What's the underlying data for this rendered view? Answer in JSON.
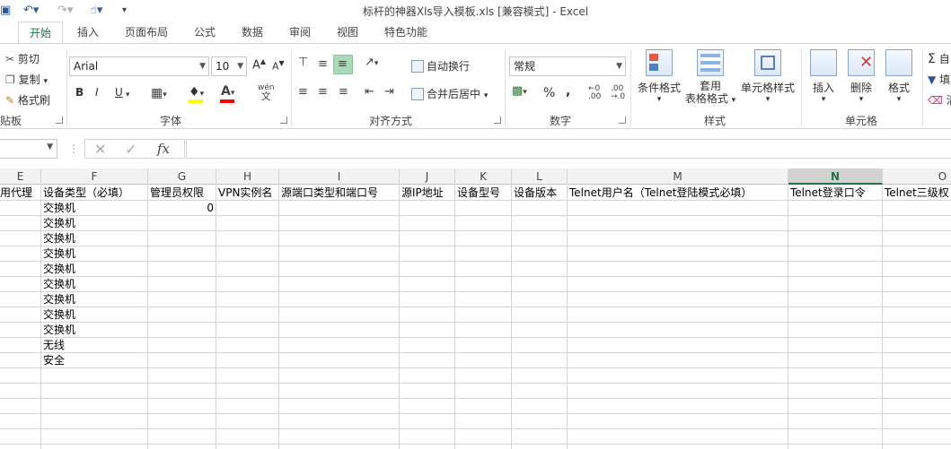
{
  "window": {
    "title": "标杆的神器Xls导入模板.xls  [兼容模式] - Excel"
  },
  "tabs": [
    "开始",
    "插入",
    "页面布局",
    "公式",
    "数据",
    "审阅",
    "视图",
    "特色功能"
  ],
  "clipboard": {
    "cut": "剪切",
    "copy": "复制",
    "painter": "格式刷",
    "label": "贴板"
  },
  "font": {
    "name": "Arial",
    "size": "10",
    "bold": "B",
    "italic": "I",
    "underline": "U",
    "grow": "A",
    "shrink": "A",
    "label": "字体"
  },
  "alignment": {
    "wrap": "自动换行",
    "merge": "合并后居中",
    "label": "对齐方式"
  },
  "number": {
    "format": "常规",
    "percent": "%",
    "comma": ",",
    "label": "数字"
  },
  "styles": {
    "conditional": "条件格式",
    "table_line1": "套用",
    "table_line2": "表格格式",
    "cell_styles": "单元格样式",
    "label": "样式"
  },
  "cells_group": {
    "insert": "插入",
    "delete": "删除",
    "format": "格式",
    "label": "单元格"
  },
  "editing": {
    "partial1": "自",
    "partial2": "填",
    "partial3": "清"
  },
  "formula_bar": {
    "fx": "fx",
    "value": ""
  },
  "columns": [
    "E",
    "F",
    "G",
    "H",
    "I",
    "J",
    "K",
    "L",
    "M",
    "N",
    "O"
  ],
  "selected_column": "N",
  "headers_row": [
    "用代理",
    "设备类型（必填）",
    "管理员权限",
    "VPN实例名",
    "源端口类型和端口号",
    "源IP地址",
    "设备型号",
    "设备版本",
    "Telnet用户名（Telnet登陆模式必填）",
    "Telnet登录口令",
    "Telnet三级权"
  ],
  "device_types": [
    "交换机",
    "交换机",
    "交换机",
    "交换机",
    "交换机",
    "交换机",
    "交换机",
    "交换机",
    "交换机",
    "无线",
    "安全"
  ],
  "admin_value": "0",
  "colors": {
    "accent": "#217346",
    "grid": "#d4d4d4",
    "header_bg": "#f2f2f2"
  }
}
